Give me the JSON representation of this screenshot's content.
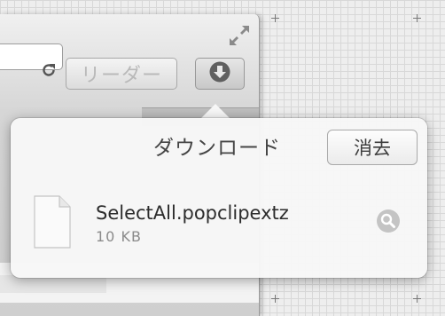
{
  "toolbar": {
    "reader_label": "リーダー",
    "reload_icon": "reload-icon",
    "download_icon": "download-icon",
    "fullscreen_icon": "fullscreen-icon"
  },
  "downloads": {
    "title": "ダウンロード",
    "clear_label": "消去",
    "items": [
      {
        "name": "SelectAll.popclipextz",
        "size": "10 KB",
        "icon": "document-icon",
        "action_icon": "magnifier-icon"
      }
    ]
  },
  "colors": {
    "accent": "#5f5f5f",
    "panel": "#f7f7f7"
  }
}
